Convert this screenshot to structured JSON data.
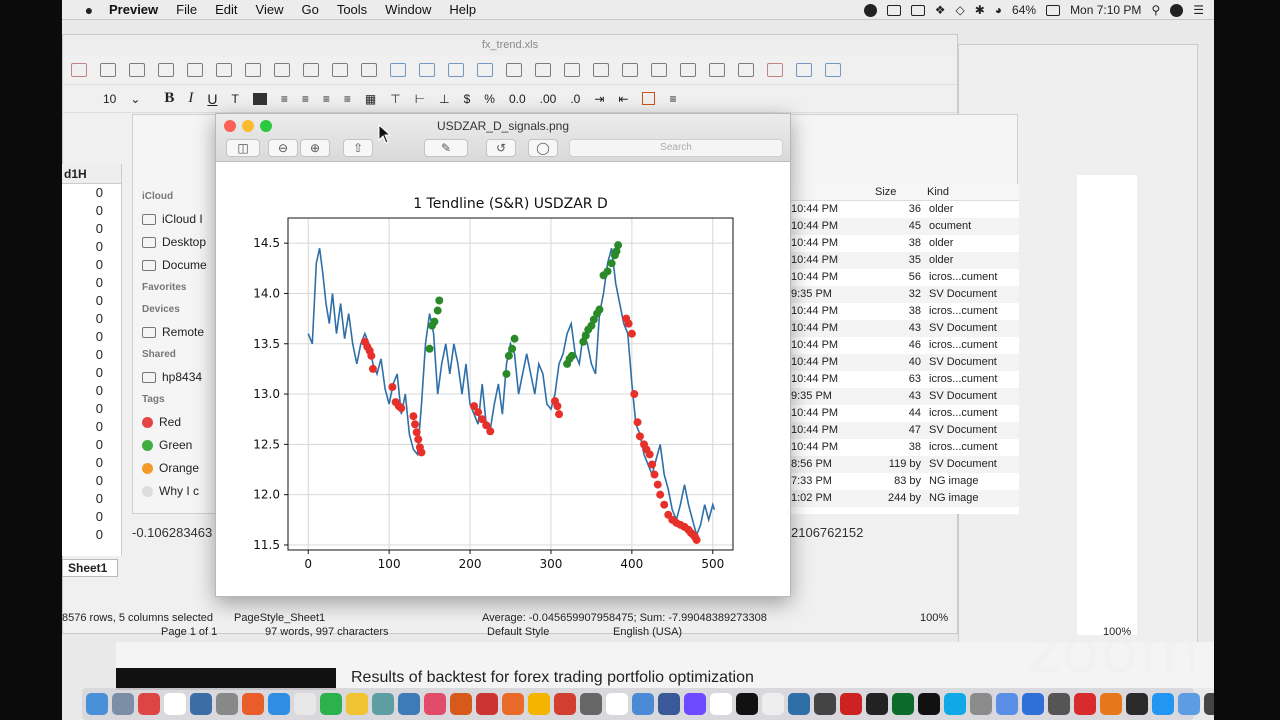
{
  "menubar": {
    "app": "Preview",
    "items": [
      "File",
      "Edit",
      "View",
      "Go",
      "Tools",
      "Window",
      "Help"
    ],
    "battery": "64%",
    "clock": "Mon 7:10 PM"
  },
  "calc": {
    "title": "fx_trend.xls",
    "font_size": "10",
    "column_header": "d1H",
    "cells": [
      "0",
      "0",
      "0",
      "0",
      "0",
      "0",
      "0",
      "0",
      "0",
      "0",
      "0",
      "0",
      "0",
      "0",
      "0",
      "0",
      "0",
      "0",
      "0",
      "0"
    ],
    "neg_value": "-0.106283463",
    "right_value": "2106762152",
    "sheet_tab": "Sheet1",
    "status_rows": "8576 rows, 5 columns selected",
    "status_style": "PageStyle_Sheet1",
    "status_sum": "Average: -0.045659907958475; Sum: -7.99048389273308",
    "status_zoom": "100%"
  },
  "writer_status": {
    "page": "Page 1 of 1",
    "words": "97 words, 997 characters",
    "style": "Default Style",
    "lang": "English (USA)",
    "zoom": "100%"
  },
  "finder": {
    "sidebar": [
      {
        "section": "iCloud"
      },
      {
        "label": "iCloud I",
        "icon": "cloud-icon"
      },
      {
        "label": "Desktop",
        "icon": "desktop-icon"
      },
      {
        "label": "Docume",
        "icon": "document-icon"
      },
      {
        "section": "Favorites"
      },
      {
        "section": "Devices"
      },
      {
        "label": "Remote",
        "icon": "disc-icon"
      },
      {
        "section": "Shared"
      },
      {
        "label": "hp8434",
        "icon": "monitor-icon"
      },
      {
        "section": "Tags"
      },
      {
        "label": "Red",
        "color": "#e64545"
      },
      {
        "label": "Green",
        "color": "#3fae3f"
      },
      {
        "label": "Orange",
        "color": "#f39a2b"
      },
      {
        "label": "Why I c",
        "color": "#dddddd"
      }
    ],
    "size_header": "Size",
    "kind_header": "Kind",
    "rows": [
      {
        "d": "10:44 PM",
        "s": "36",
        "k": "older"
      },
      {
        "d": "10:44 PM",
        "s": "45",
        "k": "ocument"
      },
      {
        "d": "10:44 PM",
        "s": "38",
        "k": "older"
      },
      {
        "d": "10:44 PM",
        "s": "35",
        "k": "older"
      },
      {
        "d": "10:44 PM",
        "s": "56",
        "k": "icros...cument"
      },
      {
        "d": "9:35 PM",
        "s": "32",
        "k": "SV Document"
      },
      {
        "d": "10:44 PM",
        "s": "38",
        "k": "icros...cument"
      },
      {
        "d": "10:44 PM",
        "s": "43",
        "k": "SV Document"
      },
      {
        "d": "10:44 PM",
        "s": "46",
        "k": "icros...cument"
      },
      {
        "d": "10:44 PM",
        "s": "40",
        "k": "SV Document"
      },
      {
        "d": "10:44 PM",
        "s": "63",
        "k": "icros...cument"
      },
      {
        "d": "9:35 PM",
        "s": "43",
        "k": "SV Document"
      },
      {
        "d": "10:44 PM",
        "s": "44",
        "k": "icros...cument"
      },
      {
        "d": "10:44 PM",
        "s": "47",
        "k": "SV Document"
      },
      {
        "d": "10:44 PM",
        "s": "38",
        "k": "icros...cument"
      },
      {
        "d": "8:56 PM",
        "s": "119 by",
        "k": "SV Document"
      },
      {
        "d": "7:33 PM",
        "s": "83 by",
        "k": "NG image"
      },
      {
        "d": "1:02 PM",
        "s": "244 by",
        "k": "NG image"
      }
    ]
  },
  "preview": {
    "title": "USDZAR_D_signals.png",
    "search_placeholder": "Search"
  },
  "chart_data": {
    "type": "line",
    "title": "1 Tendline (S&R) USDZAR  D",
    "xlabel": "",
    "ylabel": "",
    "xlim": [
      -25,
      525
    ],
    "ylim": [
      11.45,
      14.75
    ],
    "xticks": [
      0,
      100,
      200,
      300,
      400,
      500
    ],
    "yticks": [
      11.5,
      12.0,
      12.5,
      13.0,
      13.5,
      14.0,
      14.5
    ],
    "grid": true,
    "series": [
      {
        "color": "#2f6fa8",
        "x": [
          0,
          5,
          10,
          14,
          18,
          22,
          26,
          30,
          35,
          40,
          45,
          50,
          55,
          60,
          65,
          70,
          75,
          80,
          85,
          90,
          95,
          100,
          105,
          110,
          115,
          120,
          125,
          130,
          135,
          140,
          145,
          150,
          155,
          160,
          165,
          170,
          175,
          180,
          185,
          190,
          195,
          200,
          205,
          210,
          215,
          220,
          225,
          230,
          235,
          240,
          245,
          250,
          255,
          260,
          265,
          270,
          275,
          280,
          285,
          290,
          295,
          300,
          305,
          310,
          315,
          320,
          325,
          330,
          335,
          340,
          345,
          350,
          355,
          360,
          365,
          370,
          375,
          380,
          385,
          390,
          395,
          400,
          405,
          410,
          415,
          420,
          425,
          430,
          435,
          440,
          445,
          450,
          455,
          460,
          465,
          470,
          475,
          480,
          485,
          490,
          495,
          500,
          502
        ],
        "y": [
          13.6,
          13.5,
          14.3,
          14.45,
          14.2,
          13.9,
          13.7,
          14.0,
          13.6,
          13.9,
          13.55,
          13.8,
          13.5,
          13.3,
          13.5,
          13.6,
          13.5,
          13.3,
          13.2,
          13.35,
          13.05,
          12.9,
          13.1,
          13.2,
          12.8,
          13.0,
          12.6,
          12.45,
          12.4,
          12.9,
          13.5,
          13.8,
          13.6,
          13.0,
          13.3,
          13.5,
          13.2,
          13.5,
          13.3,
          13.0,
          13.3,
          12.9,
          12.8,
          12.7,
          13.1,
          12.7,
          12.65,
          12.9,
          13.1,
          12.8,
          13.3,
          13.5,
          13.4,
          13.0,
          13.2,
          13.4,
          13.2,
          13.0,
          13.3,
          13.2,
          12.9,
          12.85,
          13.0,
          13.3,
          13.4,
          13.6,
          13.7,
          13.4,
          13.3,
          13.6,
          13.5,
          13.3,
          13.2,
          13.8,
          14.0,
          14.3,
          14.45,
          14.1,
          13.9,
          13.7,
          13.6,
          13.1,
          12.7,
          12.6,
          12.4,
          12.3,
          12.2,
          12.35,
          12.5,
          12.2,
          12.05,
          11.85,
          11.75,
          11.9,
          12.1,
          11.9,
          11.75,
          11.6,
          11.7,
          11.9,
          11.75,
          11.9,
          11.85
        ]
      }
    ],
    "sell_signals": {
      "color": "#e8302b",
      "x": [
        70,
        73,
        76,
        78,
        80,
        104,
        108,
        112,
        115,
        130,
        132,
        134,
        136,
        138,
        140,
        205,
        210,
        215,
        220,
        225,
        305,
        308,
        310,
        393,
        396,
        400,
        403,
        407,
        410,
        415,
        418,
        422,
        425,
        428,
        432,
        435,
        440,
        445,
        450,
        455,
        460,
        465,
        470,
        473,
        476,
        478,
        480
      ],
      "y": [
        13.52,
        13.47,
        13.43,
        13.38,
        13.25,
        13.07,
        12.92,
        12.88,
        12.86,
        12.78,
        12.7,
        12.62,
        12.55,
        12.47,
        12.42,
        12.88,
        12.82,
        12.75,
        12.69,
        12.63,
        12.93,
        12.88,
        12.8,
        13.75,
        13.7,
        13.6,
        13.0,
        12.72,
        12.58,
        12.5,
        12.45,
        12.4,
        12.3,
        12.2,
        12.1,
        12.0,
        11.9,
        11.8,
        11.75,
        11.72,
        11.7,
        11.68,
        11.65,
        11.62,
        11.6,
        11.58,
        11.55
      ]
    },
    "buy_signals": {
      "color": "#2a8a2a",
      "x": [
        150,
        153,
        156,
        160,
        162,
        245,
        248,
        252,
        255,
        320,
        323,
        326,
        340,
        343,
        346,
        350,
        353,
        357,
        360,
        365,
        370,
        375,
        379,
        381,
        383
      ],
      "y": [
        13.45,
        13.68,
        13.72,
        13.83,
        13.93,
        13.2,
        13.38,
        13.45,
        13.55,
        13.3,
        13.35,
        13.38,
        13.52,
        13.58,
        13.64,
        13.68,
        13.74,
        13.8,
        13.84,
        14.18,
        14.22,
        14.3,
        14.38,
        14.42,
        14.48
      ]
    }
  },
  "bottom": {
    "caption": "Results of backtest for forex trading portfolio optimization",
    "watermark": "zoom"
  },
  "dock_colors": [
    "#4a90d9",
    "#7a8fa6",
    "#dd4444",
    "#ffffff",
    "#3a6ea5",
    "#888888",
    "#e85d2a",
    "#2f8de4",
    "#e8e8e8",
    "#2bb24c",
    "#f1c232",
    "#5f9ea0",
    "#3d7ab8",
    "#e14c6a",
    "#d85a1a",
    "#cc3333",
    "#e86b2a",
    "#f4b400",
    "#d23f31",
    "#666666",
    "#ffffff",
    "#4b8bd6",
    "#3b5998",
    "#6d4aff",
    "#ffffff",
    "#111111",
    "#eeeeee",
    "#2f6fa8",
    "#444444",
    "#cc2222",
    "#222222",
    "#0a6b2a",
    "#111111",
    "#11a8e8",
    "#8c8c8c",
    "#5b8ee6",
    "#2f6fd8",
    "#555555",
    "#d82b2b",
    "#e8761a",
    "#2b2b2b",
    "#2196f3",
    "#5b9de0",
    "#444444",
    "#d0d0d0",
    "#e0e0e0"
  ]
}
